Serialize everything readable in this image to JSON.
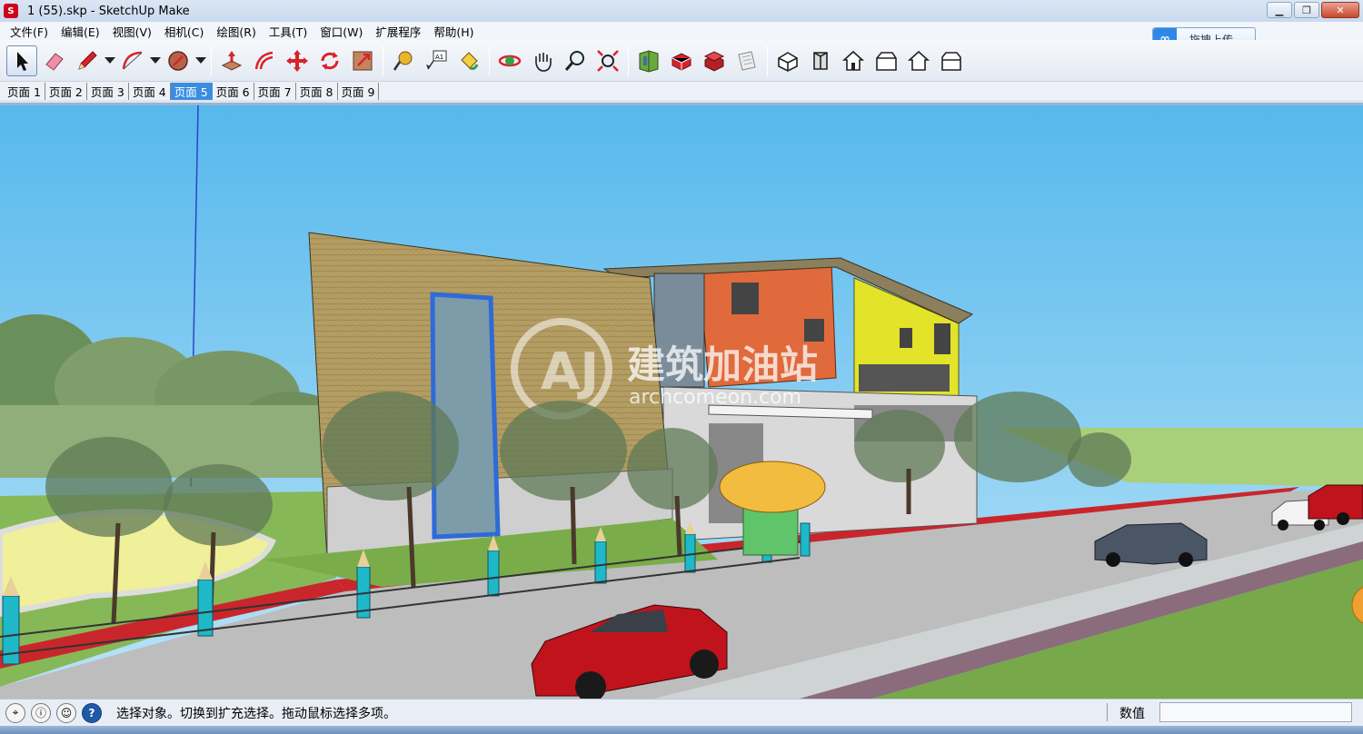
{
  "window": {
    "title": "1 (55).skp - SketchUp Make",
    "app_icon": "sketchup-icon"
  },
  "menu": [
    "文件(F)",
    "编辑(E)",
    "视图(V)",
    "相机(C)",
    "绘图(R)",
    "工具(T)",
    "窗口(W)",
    "扩展程序",
    "帮助(H)"
  ],
  "upload_button": {
    "label": "拖拽上传",
    "icon": "cloud-upload-icon"
  },
  "toolbar": {
    "tools": [
      "select-tool-icon",
      "eraser-tool-icon",
      "pencil-tool-icon",
      "arc-tool-icon",
      "shape-tool-icon",
      "push-pull-tool-icon",
      "offset-tool-icon",
      "move-tool-icon",
      "rotate-tool-icon",
      "scale-tool-icon",
      "tape-measure-tool-icon",
      "text-tool-icon",
      "paint-bucket-tool-icon",
      "orbit-tool-icon",
      "pan-tool-icon",
      "zoom-tool-icon",
      "zoom-extents-tool-icon",
      "warehouse-icon",
      "share-model-icon",
      "extension-warehouse-icon",
      "layout-icon",
      "iso-view-icon",
      "top-view-icon",
      "front-view-icon",
      "right-view-icon",
      "back-view-icon",
      "left-view-icon"
    ]
  },
  "scene_tabs": {
    "items": [
      "页面 1",
      "页面 2",
      "页面 3",
      "页面 4",
      "页面 5",
      "页面 6",
      "页面 7",
      "页面 8",
      "页面 9"
    ],
    "active_index": 4
  },
  "viewport": {
    "watermark_title": "建筑加油站",
    "watermark_url": "archcomeon.com",
    "colors": {
      "sky": "#6fc3ee",
      "grass": "#77a84a",
      "road": "#b9b9b9",
      "wall_orange": "#e06a3b",
      "wall_yellow": "#e3e32a",
      "wood": "#b49d63"
    }
  },
  "status": {
    "message": "选择对象。切换到扩充选择。拖动鼠标选择多项。",
    "measurements_label": "数值",
    "measurements_value": ""
  }
}
